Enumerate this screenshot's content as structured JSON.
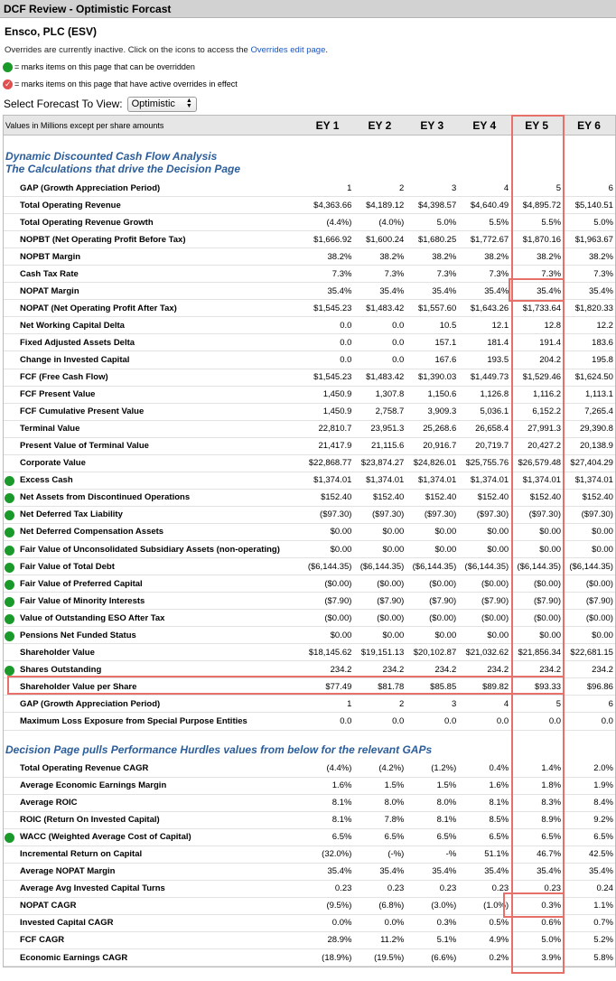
{
  "window": {
    "title": "DCF Review - Optimistic Forcast"
  },
  "company": "Ensco, PLC (ESV)",
  "overrides_note": {
    "text": "Overrides are currently inactive. Click on the icons to access the ",
    "link": "Overrides edit page",
    "end": "."
  },
  "legend": {
    "green": "= marks items on this page that can be overridden",
    "red": "= marks items on this page that have active overrides in effect"
  },
  "forecast_select": {
    "label": "Select Forecast To View:",
    "value": "Optimistic"
  },
  "table": {
    "header_label": "Values in Millions except per share amounts",
    "years": [
      "EY 1",
      "EY 2",
      "EY 3",
      "EY 4",
      "EY 5",
      "EY 6"
    ],
    "section1_title_line1": "Dynamic Discounted Cash Flow Analysis",
    "section1_title_line2": "The Calculations that drive the Decision Page",
    "section1_rows": [
      {
        "label": "GAP (Growth Appreciation Period)",
        "dot": false,
        "values": [
          "1",
          "2",
          "3",
          "4",
          "5",
          "6"
        ]
      },
      {
        "label": "Total Operating Revenue",
        "dot": false,
        "values": [
          "$4,363.66",
          "$4,189.12",
          "$4,398.57",
          "$4,640.49",
          "$4,895.72",
          "$5,140.51"
        ]
      },
      {
        "label": "Total Operating Revenue Growth",
        "dot": false,
        "values": [
          "(4.4%)",
          "(4.0%)",
          "5.0%",
          "5.5%",
          "5.5%",
          "5.0%"
        ]
      },
      {
        "label": "NOPBT (Net Operating Profit Before Tax)",
        "dot": false,
        "values": [
          "$1,666.92",
          "$1,600.24",
          "$1,680.25",
          "$1,772.67",
          "$1,870.16",
          "$1,963.67"
        ]
      },
      {
        "label": "NOPBT Margin",
        "dot": false,
        "values": [
          "38.2%",
          "38.2%",
          "38.2%",
          "38.2%",
          "38.2%",
          "38.2%"
        ]
      },
      {
        "label": "Cash Tax Rate",
        "dot": false,
        "values": [
          "7.3%",
          "7.3%",
          "7.3%",
          "7.3%",
          "7.3%",
          "7.3%"
        ]
      },
      {
        "label": "NOPAT Margin",
        "dot": false,
        "values": [
          "35.4%",
          "35.4%",
          "35.4%",
          "35.4%",
          "35.4%",
          "35.4%"
        ]
      },
      {
        "label": "NOPAT (Net Operating Profit After Tax)",
        "dot": false,
        "values": [
          "$1,545.23",
          "$1,483.42",
          "$1,557.60",
          "$1,643.26",
          "$1,733.64",
          "$1,820.33"
        ]
      },
      {
        "label": "Net Working Capital Delta",
        "dot": false,
        "values": [
          "0.0",
          "0.0",
          "10.5",
          "12.1",
          "12.8",
          "12.2"
        ]
      },
      {
        "label": "Fixed Adjusted Assets Delta",
        "dot": false,
        "values": [
          "0.0",
          "0.0",
          "157.1",
          "181.4",
          "191.4",
          "183.6"
        ]
      },
      {
        "label": "Change in Invested Capital",
        "dot": false,
        "values": [
          "0.0",
          "0.0",
          "167.6",
          "193.5",
          "204.2",
          "195.8"
        ]
      },
      {
        "label": "FCF (Free Cash Flow)",
        "dot": false,
        "values": [
          "$1,545.23",
          "$1,483.42",
          "$1,390.03",
          "$1,449.73",
          "$1,529.46",
          "$1,624.50"
        ]
      },
      {
        "label": "FCF Present Value",
        "dot": false,
        "values": [
          "1,450.9",
          "1,307.8",
          "1,150.6",
          "1,126.8",
          "1,116.2",
          "1,113.1"
        ]
      },
      {
        "label": "FCF Cumulative Present Value",
        "dot": false,
        "values": [
          "1,450.9",
          "2,758.7",
          "3,909.3",
          "5,036.1",
          "6,152.2",
          "7,265.4"
        ]
      },
      {
        "label": "Terminal Value",
        "dot": false,
        "values": [
          "22,810.7",
          "23,951.3",
          "25,268.6",
          "26,658.4",
          "27,991.3",
          "29,390.8"
        ]
      },
      {
        "label": "Present Value of Terminal Value",
        "dot": false,
        "values": [
          "21,417.9",
          "21,115.6",
          "20,916.7",
          "20,719.7",
          "20,427.2",
          "20,138.9"
        ]
      },
      {
        "label": "Corporate Value",
        "dot": false,
        "values": [
          "$22,868.77",
          "$23,874.27",
          "$24,826.01",
          "$25,755.76",
          "$26,579.48",
          "$27,404.29"
        ]
      },
      {
        "label": "Excess Cash",
        "dot": true,
        "values": [
          "$1,374.01",
          "$1,374.01",
          "$1,374.01",
          "$1,374.01",
          "$1,374.01",
          "$1,374.01"
        ]
      },
      {
        "label": "Net Assets from Discontinued Operations",
        "dot": true,
        "values": [
          "$152.40",
          "$152.40",
          "$152.40",
          "$152.40",
          "$152.40",
          "$152.40"
        ]
      },
      {
        "label": "Net Deferred Tax Liability",
        "dot": true,
        "values": [
          "($97.30)",
          "($97.30)",
          "($97.30)",
          "($97.30)",
          "($97.30)",
          "($97.30)"
        ]
      },
      {
        "label": "Net Deferred Compensation Assets",
        "dot": true,
        "values": [
          "$0.00",
          "$0.00",
          "$0.00",
          "$0.00",
          "$0.00",
          "$0.00"
        ]
      },
      {
        "label": "Fair Value of Unconsolidated Subsidiary Assets (non-operating)",
        "dot": true,
        "values": [
          "$0.00",
          "$0.00",
          "$0.00",
          "$0.00",
          "$0.00",
          "$0.00"
        ]
      },
      {
        "label": "Fair Value of Total Debt",
        "dot": true,
        "values": [
          "($6,144.35)",
          "($6,144.35)",
          "($6,144.35)",
          "($6,144.35)",
          "($6,144.35)",
          "($6,144.35)"
        ]
      },
      {
        "label": "Fair Value of Preferred Capital",
        "dot": true,
        "values": [
          "($0.00)",
          "($0.00)",
          "($0.00)",
          "($0.00)",
          "($0.00)",
          "($0.00)"
        ]
      },
      {
        "label": "Fair Value of Minority Interests",
        "dot": true,
        "values": [
          "($7.90)",
          "($7.90)",
          "($7.90)",
          "($7.90)",
          "($7.90)",
          "($7.90)"
        ]
      },
      {
        "label": "Value of Outstanding ESO After Tax",
        "dot": true,
        "values": [
          "($0.00)",
          "($0.00)",
          "($0.00)",
          "($0.00)",
          "($0.00)",
          "($0.00)"
        ]
      },
      {
        "label": "Pensions Net Funded Status",
        "dot": true,
        "values": [
          "$0.00",
          "$0.00",
          "$0.00",
          "$0.00",
          "$0.00",
          "$0.00"
        ]
      },
      {
        "label": "Shareholder Value",
        "dot": false,
        "values": [
          "$18,145.62",
          "$19,151.13",
          "$20,102.87",
          "$21,032.62",
          "$21,856.34",
          "$22,681.15"
        ]
      },
      {
        "label": "Shares Outstanding",
        "dot": true,
        "values": [
          "234.2",
          "234.2",
          "234.2",
          "234.2",
          "234.2",
          "234.2"
        ]
      },
      {
        "label": "Shareholder Value per Share",
        "dot": false,
        "values": [
          "$77.49",
          "$81.78",
          "$85.85",
          "$89.82",
          "$93.33",
          "$96.86"
        ]
      },
      {
        "label": "GAP (Growth Appreciation Period)",
        "dot": false,
        "values": [
          "1",
          "2",
          "3",
          "4",
          "5",
          "6"
        ]
      },
      {
        "label": "Maximum Loss Exposure from Special Purpose Entities",
        "dot": false,
        "values": [
          "0.0",
          "0.0",
          "0.0",
          "0.0",
          "0.0",
          "0.0"
        ]
      }
    ],
    "section2_title": "Decision Page pulls Performance Hurdles values from below for the relevant GAPs",
    "section2_rows": [
      {
        "label": "Total Operating Revenue CAGR",
        "dot": false,
        "values": [
          "(4.4%)",
          "(4.2%)",
          "(1.2%)",
          "0.4%",
          "1.4%",
          "2.0%"
        ]
      },
      {
        "label": "Average Economic Earnings Margin",
        "dot": false,
        "values": [
          "1.6%",
          "1.5%",
          "1.5%",
          "1.6%",
          "1.8%",
          "1.9%"
        ]
      },
      {
        "label": "Average ROIC",
        "dot": false,
        "values": [
          "8.1%",
          "8.0%",
          "8.0%",
          "8.1%",
          "8.3%",
          "8.4%"
        ]
      },
      {
        "label": "ROIC (Return On Invested Capital)",
        "dot": false,
        "values": [
          "8.1%",
          "7.8%",
          "8.1%",
          "8.5%",
          "8.9%",
          "9.2%"
        ]
      },
      {
        "label": "WACC (Weighted Average Cost of Capital)",
        "dot": true,
        "values": [
          "6.5%",
          "6.5%",
          "6.5%",
          "6.5%",
          "6.5%",
          "6.5%"
        ]
      },
      {
        "label": "Incremental Return on Capital",
        "dot": false,
        "values": [
          "(32.0%)",
          "(-%)",
          "-%",
          "51.1%",
          "46.7%",
          "42.5%"
        ]
      },
      {
        "label": "Average NOPAT Margin",
        "dot": false,
        "values": [
          "35.4%",
          "35.4%",
          "35.4%",
          "35.4%",
          "35.4%",
          "35.4%"
        ]
      },
      {
        "label": "Average Avg Invested Capital Turns",
        "dot": false,
        "values": [
          "0.23",
          "0.23",
          "0.23",
          "0.23",
          "0.23",
          "0.24"
        ]
      },
      {
        "label": "NOPAT CAGR",
        "dot": false,
        "values": [
          "(9.5%)",
          "(6.8%)",
          "(3.0%)",
          "(1.0%)",
          "0.3%",
          "1.1%"
        ]
      },
      {
        "label": "Invested Capital CAGR",
        "dot": false,
        "values": [
          "0.0%",
          "0.0%",
          "0.3%",
          "0.5%",
          "0.6%",
          "0.7%"
        ]
      },
      {
        "label": "FCF CAGR",
        "dot": false,
        "values": [
          "28.9%",
          "11.2%",
          "5.1%",
          "4.9%",
          "5.0%",
          "5.2%"
        ]
      },
      {
        "label": "Economic Earnings CAGR",
        "dot": false,
        "values": [
          "(18.9%)",
          "(19.5%)",
          "(6.6%)",
          "0.2%",
          "3.9%",
          "5.8%"
        ]
      }
    ]
  },
  "colors": {
    "title_bar": "#d2d2d2",
    "section_title": "#2b5d9a",
    "link": "#1a57c4",
    "override_dot": "#1a9a2a",
    "active_override_dot": "#e05050",
    "highlight": "#e8706a"
  }
}
